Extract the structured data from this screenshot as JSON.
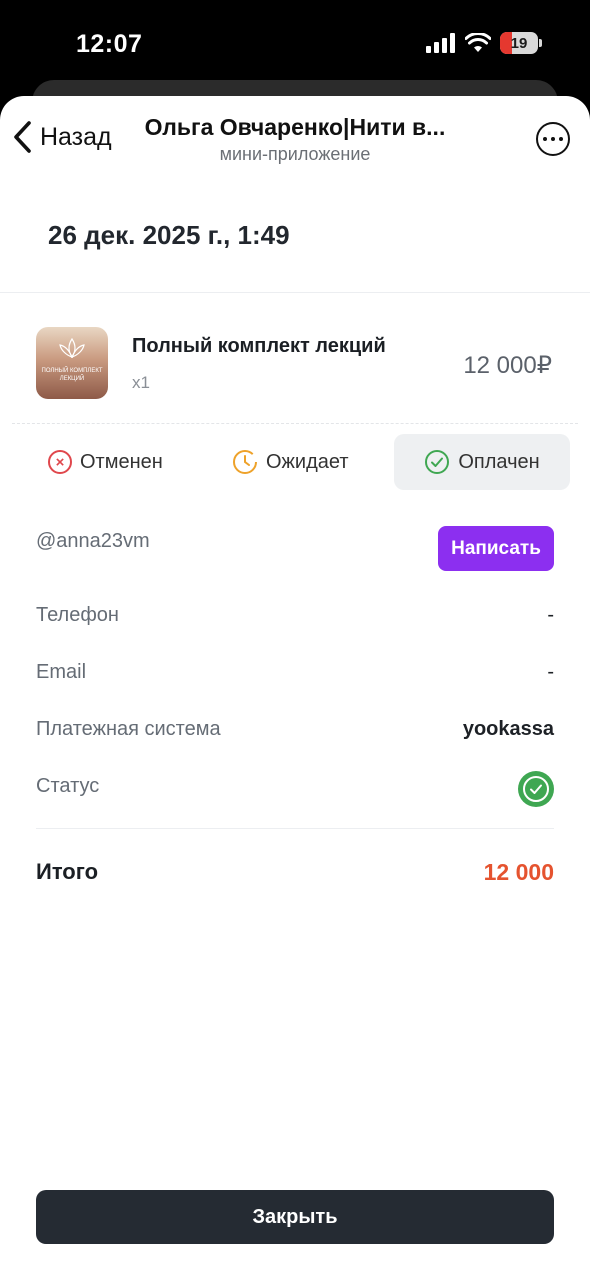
{
  "statusbar": {
    "time": "12:07",
    "battery": "19",
    "icons": [
      "cellular-signal-icon",
      "wifi-icon",
      "battery-icon"
    ]
  },
  "nav": {
    "back_label": "Назад",
    "title": "Ольга Овчаренко|Нити в...",
    "subtitle": "мини-приложение",
    "more_icon": "more-icon"
  },
  "order": {
    "date": "26 дек. 2025 г., 1:49",
    "product": {
      "name": "Полный комплект лекций",
      "thumb_text": "ПОЛНЫЙ КОМПЛЕКТ ЛЕКЦИЙ",
      "qty": "x1",
      "price": "12 000₽"
    },
    "status_tabs": [
      {
        "label": "Отменен",
        "icon": "cancel-icon",
        "color": "#e0474c"
      },
      {
        "label": "Ожидает",
        "icon": "clock-icon",
        "color": "#eea22a"
      },
      {
        "label": "Оплачен",
        "icon": "check-circle-icon",
        "color": "#3fa752",
        "selected": true
      }
    ],
    "user": {
      "handle": "@anna23vm",
      "write_label": "Написать"
    },
    "fields": [
      {
        "label": "Телефон",
        "value": "-"
      },
      {
        "label": "Email",
        "value": "-"
      },
      {
        "label": "Платежная система",
        "value": "yookassa"
      },
      {
        "label": "Статус",
        "value_icon": "status-ok-icon"
      }
    ],
    "total": {
      "label": "Итого",
      "value": "12 000"
    }
  },
  "footer": {
    "close_label": "Закрыть"
  },
  "colors": {
    "accent": "#8c2ff0",
    "total": "#e5532f",
    "button_dark": "#252b33",
    "success": "#3fa752"
  }
}
